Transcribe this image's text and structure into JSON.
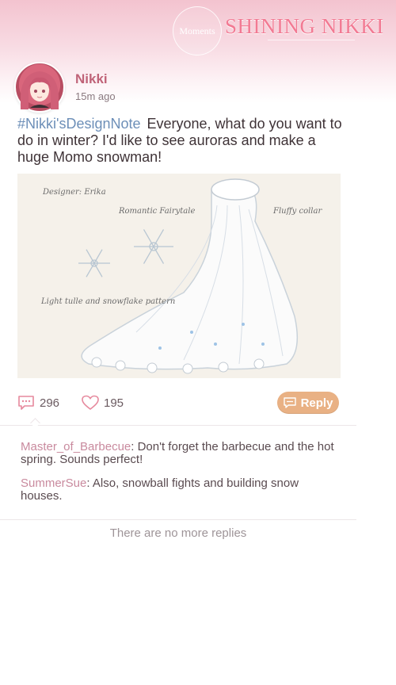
{
  "header": {
    "moments_label": "Moments",
    "game_logo": "SHINING NIKKI"
  },
  "post": {
    "author": "Nikki",
    "time": "15m ago",
    "hashtag": "#Nikki'sDesignNote",
    "text": "Everyone, what do you want to do in winter? I'd like to see auroras and make a huge Momo snowman!",
    "image": {
      "labels": {
        "designer": "Designer: Erika",
        "style": "Romantic Fairytale",
        "collar": "Fluffy collar",
        "pattern": "Light tulle and snowflake pattern"
      }
    }
  },
  "actions": {
    "comment_count": "296",
    "like_count": "195",
    "reply_label": "Reply"
  },
  "replies": [
    {
      "author": "Master_of_Barbecue",
      "separator": ":",
      "text": "Don't forget the barbecue and the hot spring. Sounds perfect!"
    },
    {
      "author": "SummerSue",
      "separator": ":",
      "text": "Also, snowball fights and building snow houses."
    }
  ],
  "footer": {
    "no_more_replies": "There are no more replies"
  },
  "colors": {
    "accent_pink": "#c06378",
    "hashtag_blue": "#6d8fb8",
    "reply_button": "#e9b184",
    "reply_author": "#c98a9e"
  }
}
